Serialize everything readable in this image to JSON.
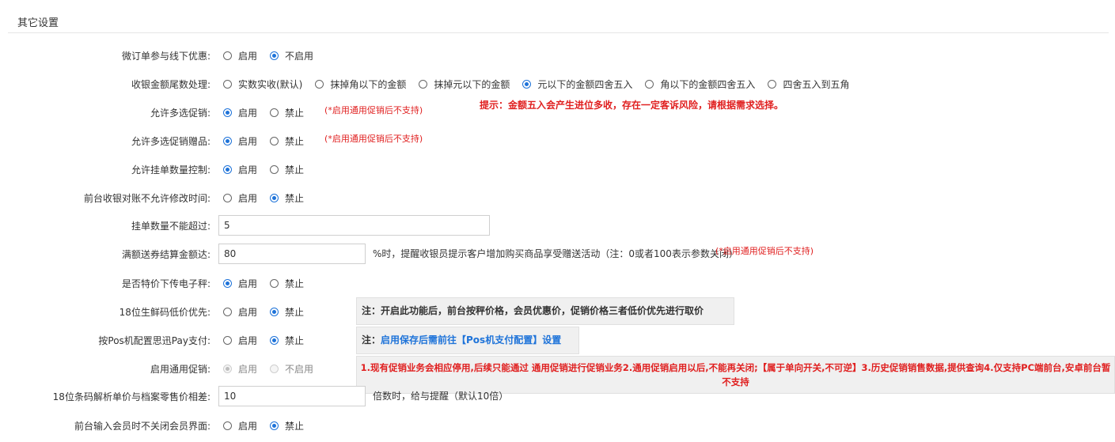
{
  "section": {
    "title": "其它设置"
  },
  "rows": [
    {
      "label": "微订单参与线下优惠:",
      "options": [
        "启用",
        "不启用"
      ]
    },
    {
      "label": "收银金额尾数处理:",
      "options": [
        "实数实收(默认)",
        "抹掉角以下的金额",
        "抹掉元以下的金额",
        "元以下的金额四舍五入",
        "角以下的金额四舍五入",
        "四舍五入到五角"
      ]
    },
    {
      "label": "允许多选促销:",
      "options": [
        "启用",
        "禁止"
      ],
      "note": "(*启用通用促销后不支持)"
    },
    {
      "label": "允许多选促销赠品:",
      "options": [
        "启用",
        "禁止"
      ],
      "note": "(*启用通用促销后不支持)"
    },
    {
      "label": "允许挂单数量控制:",
      "options": [
        "启用",
        "禁止"
      ]
    },
    {
      "label": "前台收银对账不允许修改时间:",
      "options": [
        "启用",
        "禁止"
      ]
    },
    {
      "label": "挂单数量不能超过:",
      "value": "5"
    },
    {
      "label": "满额送券结算金额达:",
      "value": "80",
      "suffix": "%时，提醒收银员提示客户增加购买商品享受赠送活动（注：0或者100表示参数关闭）",
      "note": "(*启用通用促销后不支持)"
    },
    {
      "label": "是否特价下传电子秤:",
      "options": [
        "启用",
        "禁止"
      ]
    },
    {
      "label": "18位生鲜码低价优先:",
      "options": [
        "启用",
        "禁止"
      ]
    },
    {
      "label": "按Pos机配置思迅Pay支付:",
      "options": [
        "启用",
        "禁止"
      ]
    },
    {
      "label": "启用通用促销:",
      "options": [
        "启用",
        "不启用"
      ]
    },
    {
      "label": "18位条码解析单价与档案零售价相差:",
      "value": "10",
      "suffix": "倍数时，给与提醒（默认10倍）"
    },
    {
      "label": "前台输入会员时不关闭会员界面:",
      "options": [
        "启用",
        "禁止"
      ]
    }
  ],
  "hint": "提示：金额五入会产生进位多收，存在一定客诉风险，请根据需求选择。",
  "notes": {
    "lowprice": "注：开启此功能后，前台按秤价格，会员优惠价，促销价格三者低价优先进行取价",
    "pos_prefix": "注：",
    "pos_blue": "启用保存后需前往【Pos机支付配置】设置",
    "general": "1.现有促销业务会相应停用,后续只能通过 通用促销进行促销业务2.通用促销启用以后,不能再关闭;【属于单向开关,不可逆】3.历史促销销售数据,提供查询4.仅支持PC端前台,安卓前台暂不支持"
  },
  "colors": {
    "accent": "#1e73d9",
    "warning": "#e02020",
    "note_bg": "#f0f0f0"
  }
}
